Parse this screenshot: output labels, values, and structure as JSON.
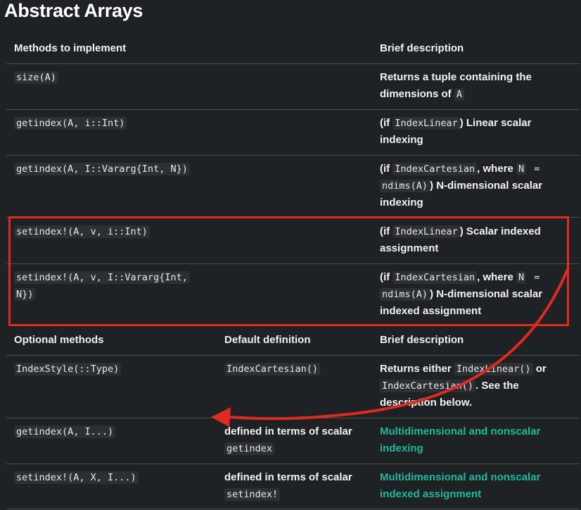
{
  "page_title": "Abstract Arrays",
  "table1": {
    "headers": [
      "Methods to implement",
      "Brief description"
    ],
    "rows": [
      {
        "method": "size(A)",
        "desc_parts": [
          {
            "t": "Returns a tuple containing the"
          },
          {
            "t": "dimensions of "
          },
          {
            "c": "A"
          }
        ]
      },
      {
        "method": "getindex(A, i::Int)",
        "desc": "(if IndexLinear) Linear scalar indexing"
      },
      {
        "method": "getindex(A, I::Vararg{Int, N})",
        "desc": "(if IndexCartesian, where N = ndims(A)) N-dimensional scalar indexing"
      },
      {
        "method": "setindex!(A, v, i::Int)",
        "desc": "(if IndexLinear) Scalar indexed assignment"
      },
      {
        "method_line1": "setindex!(A, v, I::Vararg{Int,",
        "method_line2": "N})",
        "desc": "(if IndexCartesian, where N = ndims(A)) N-dimensional scalar indexed assignment"
      }
    ]
  },
  "table2": {
    "headers": [
      "Optional methods",
      "Default definition",
      "Brief description"
    ],
    "rows": [
      {
        "method": "IndexStyle(::Type)",
        "default": "IndexCartesian()",
        "desc": "Returns either IndexLinear() or IndexCartesian(). See the description below."
      },
      {
        "method": "getindex(A, I...)",
        "default_line1": "defined in terms of scalar",
        "default_code": "getindex",
        "desc_link": "Multidimensional and nonscalar indexing"
      },
      {
        "method": "setindex!(A, X, I...)",
        "default_line1": "defined in terms of scalar",
        "default_code": "setindex!",
        "desc_link": "Multidimensional and nonscalar indexed assignment"
      }
    ]
  },
  "code_tokens": {
    "IndexLinear": "IndexLinear",
    "IndexCartesian": "IndexCartesian",
    "N": "N",
    "ndims": "ndims(A)",
    "A": "A",
    "IndexLinearCall": "IndexLinear()",
    "IndexCartesianCall": "IndexCartesian()"
  },
  "text_fragments": {
    "if_open": "(if ",
    "where": ", where ",
    "eq": " =",
    "close_paren": ")",
    "linear_scalar": ") Linear scalar",
    "indexing": "indexing",
    "ndim_scalar": ") N-dimensional scalar",
    "scalar_indexed": ") Scalar indexed",
    "assignment": "assignment",
    "indexed_assignment": "indexed assignment",
    "returns_either": "Returns either ",
    "or": " or",
    "see_the": ". See the",
    "description_below": "description below.",
    "link1_line1": "Multidimensional and nonscalar",
    "link1_line2": "indexing",
    "link2_line1": "Multidimensional and nonscalar",
    "link2_line2": "indexed assignment"
  },
  "annotation": {
    "box_color": "#e02a1f",
    "arrow_color": "#e02a1f"
  }
}
